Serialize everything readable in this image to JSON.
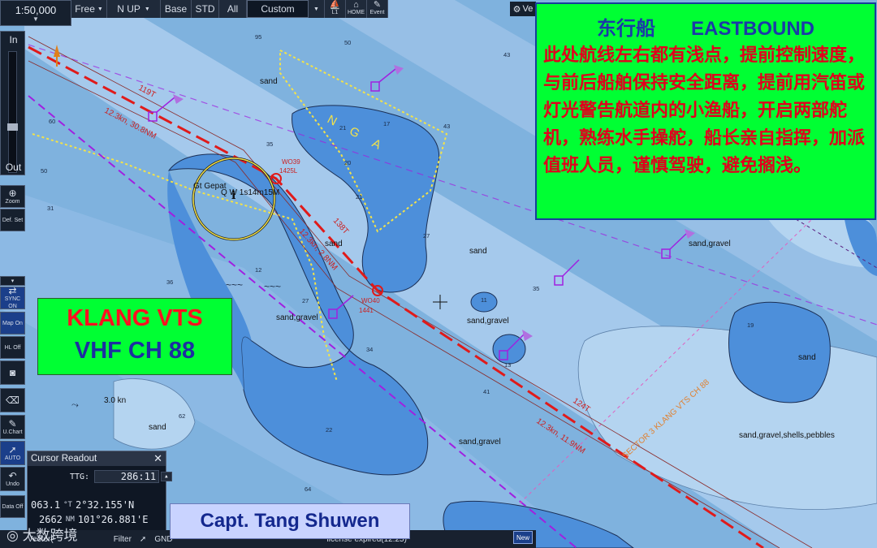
{
  "toolbar": {
    "scale": "1:50,000",
    "free": "Free",
    "orientation": "N UP",
    "base": "Base",
    "std": "STD",
    "all": "All",
    "custom": "Custom",
    "chart_label": "L1",
    "home": "HOME",
    "event": "Event",
    "vector_badge": "Ve"
  },
  "zoom": {
    "in": "In",
    "out": "Out"
  },
  "side_buttons": {
    "zoom": "Zoom",
    "def_set": "Def. Set",
    "sync": "SYNC ON",
    "map": "Map On",
    "hl": "HL Off",
    "uchart": "U.Chart",
    "auto": "AUTO",
    "undo": "Undo",
    "data": "Data Off"
  },
  "cursor_readout": {
    "title": "Cursor Readout",
    "ttg_label": "TTG:",
    "ttg_value": "286:11",
    "bearing": "063.1",
    "bearing_unit": "°T",
    "lat": "2°32.155'N",
    "distance": "2662",
    "distance_unit": "NM",
    "lon": "101°26.881'E"
  },
  "bottom_bar": {
    "vector": "Vector(",
    "filter": "Filter",
    "gnd": "GND",
    "license": "license expired(12:25)",
    "new": "New"
  },
  "overlay": {
    "eastbound_cn": "东行船",
    "eastbound_en": "EASTBOUND",
    "warning": "此处航线左右都有浅点，提前控制速度，与前后船舶保持安全距离，提前用汽笛或灯光警告航道内的小渔船，开启两部舵机，熟练水手操舵，船长亲自指挥，加派值班人员，谨慎驾驶，避免搁浅。",
    "vts_name": "KLANG VTS",
    "vts_channel": "VHF CH 88",
    "captain": "Capt. Tang Shuwen",
    "watermark": "大数跨境"
  },
  "chart": {
    "route_labels": [
      "119T",
      "12.3kn, 30.8NM",
      "138T",
      "12.3kn, 2.8NM",
      "124T",
      "12.3kn, 11.9NM"
    ],
    "waypoints": [
      "WO39",
      "1425L",
      "WO40",
      "1441"
    ],
    "area_label": "NGA",
    "sector_label": "SECTOR 3 KLANG VTS CH 88",
    "light": "Q W 1s14m15M",
    "place": "Gt Gepat",
    "seabed": [
      "sand",
      "sand",
      "sand,gravel",
      "sand,gravel",
      "sand,gravel",
      "sand",
      "sand,gravel",
      "sand",
      "sand,gravel,shells,pebbles",
      "sand"
    ],
    "current": "3.0 kn",
    "depths": [
      "95",
      "50",
      "43",
      "60",
      "50",
      "35",
      "21",
      "17",
      "20",
      "43",
      "21",
      "27",
      "12",
      "36",
      "27",
      "11",
      "34",
      "13",
      "19",
      "41",
      "62",
      "22",
      "64",
      "31",
      "35",
      "35"
    ],
    "colors": {
      "deep": "#7fb2de",
      "channel": "#9ec4ea",
      "shoal": "#4d8fda",
      "route": "#e01a1a",
      "track": "#a020e0"
    }
  }
}
